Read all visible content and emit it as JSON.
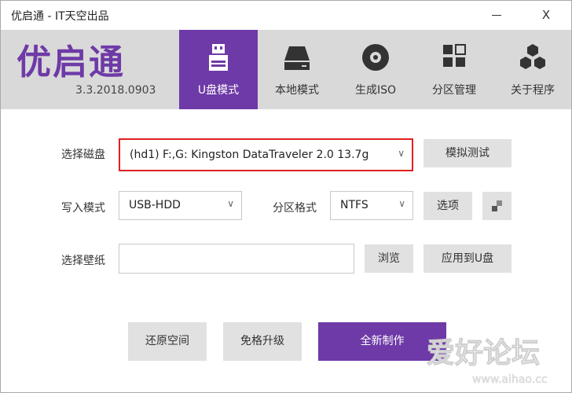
{
  "window": {
    "title": "优启通 - IT天空出品",
    "minimize_icon": "minimize-icon",
    "close_label": "X"
  },
  "header": {
    "logo_text": "优启通",
    "version": "3.3.2018.0903"
  },
  "tabs": [
    {
      "label": "U盘模式",
      "icon": "usb-drive-icon",
      "active": true
    },
    {
      "label": "本地模式",
      "icon": "hard-drive-icon",
      "active": false
    },
    {
      "label": "生成ISO",
      "icon": "disc-icon",
      "active": false
    },
    {
      "label": "分区管理",
      "icon": "partition-grid-icon",
      "active": false
    },
    {
      "label": "关于程序",
      "icon": "cubes-icon",
      "active": false
    }
  ],
  "form": {
    "disk_label": "选择磁盘",
    "disk_value": "(hd1) F:,G: Kingston DataTraveler 2.0 13.7g",
    "simulate_button": "模拟测试",
    "write_mode_label": "写入模式",
    "write_mode_value": "USB-HDD",
    "partition_format_label": "分区格式",
    "partition_format_value": "NTFS",
    "options_button": "选项",
    "wallpaper_label": "选择壁纸",
    "wallpaper_value": "",
    "browse_button": "浏览",
    "apply_to_usb_button": "应用到U盘"
  },
  "actions": {
    "restore_space": "还原空间",
    "free_upgrade": "免格升级",
    "new_make": "全新制作"
  },
  "watermark": {
    "line1": "爱好论坛",
    "line2": "www.aihao.cc"
  },
  "colors": {
    "accent": "#6e3aa7",
    "nav_bg": "#d9d9d9",
    "highlight_border": "#e02020",
    "button_bg": "#e1e1e1"
  }
}
